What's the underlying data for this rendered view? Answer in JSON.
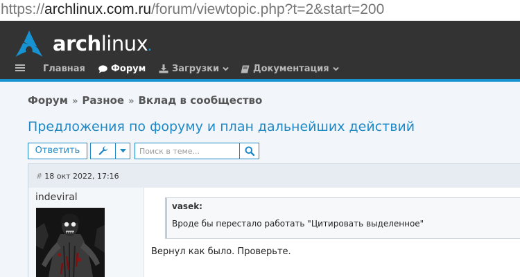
{
  "browser": {
    "url_scheme": "https://",
    "url_host": "archlinux.com.ru",
    "url_path": "/forum/viewtopic.php?t=2&start=200"
  },
  "header": {
    "logo_arch": "arch",
    "logo_linux": "linux",
    "logo_dot": ".",
    "nav": [
      {
        "label": "Главная"
      },
      {
        "label": "Форум"
      },
      {
        "label": "Загрузки"
      },
      {
        "label": "Документация"
      }
    ]
  },
  "breadcrumb": {
    "items": [
      "Форум",
      "Разное",
      "Вклад в сообщество"
    ],
    "separator": "»"
  },
  "topic": {
    "title": "Предложения по форуму и план дальнейших действий"
  },
  "actions": {
    "reply_label": "Ответить",
    "search_placeholder": "Поиск в теме..."
  },
  "post": {
    "hash": "#",
    "date": "18 окт 2022, 17:16",
    "author": "indeviral",
    "quote_author": "vasek:",
    "quote_text": "Вроде бы перестало работать \"Цитировать выделенное\"",
    "text": "Вернул как было. Проверьте."
  },
  "colors": {
    "accent": "#1793d1",
    "link": "#1e88c7",
    "header_bg": "#333333"
  }
}
